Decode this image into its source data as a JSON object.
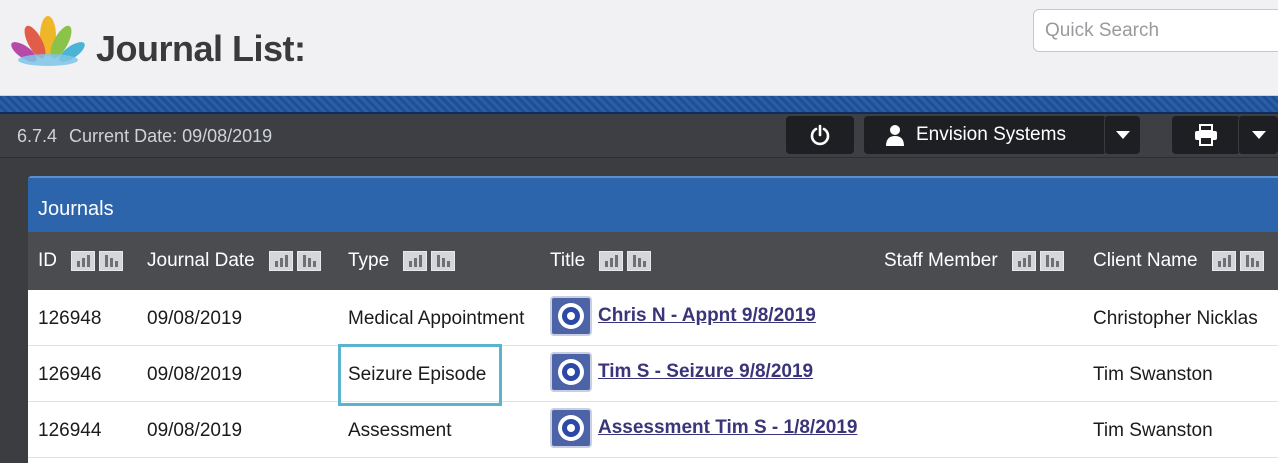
{
  "header": {
    "title": "Journal List:",
    "search_placeholder": "Quick Search"
  },
  "toolbar": {
    "version": "6.7.4",
    "current_date": "Current Date: 09/08/2019",
    "user_label": "Envision Systems"
  },
  "panel": {
    "title": "Journals",
    "columns": [
      "ID",
      "Journal Date",
      "Type",
      "Title",
      "Staff Member",
      "Client Name"
    ],
    "rows": [
      {
        "id": "126948",
        "date": "09/08/2019",
        "type": "Medical Appointment",
        "title": "Chris N - Appnt 9/8/2019",
        "staff": "",
        "client": "Christopher Nicklas"
      },
      {
        "id": "126946",
        "date": "09/08/2019",
        "type": "Seizure Episode",
        "title": "Tim S - Seizure 9/8/2019",
        "staff": "",
        "client": "Tim Swanston"
      },
      {
        "id": "126944",
        "date": "09/08/2019",
        "type": "Assessment",
        "title": "Assessment Tim S - 1/8/2019",
        "staff": "",
        "client": "Tim Swanston"
      }
    ]
  },
  "colors": {
    "panel_header": "#2d65ad",
    "table_header": "#4b4c50",
    "highlight": "#5ab4d0",
    "link": "#3a3578"
  }
}
